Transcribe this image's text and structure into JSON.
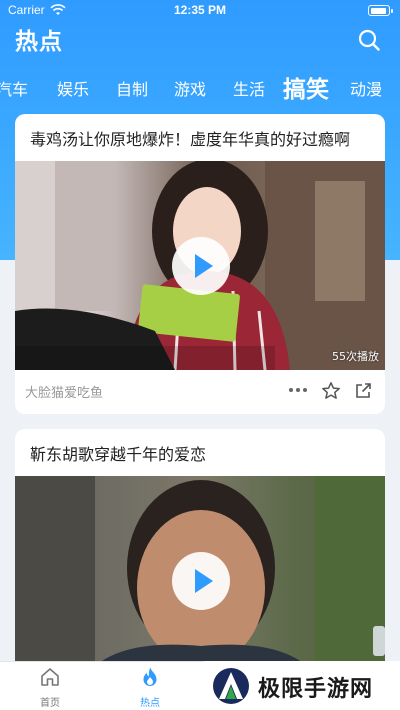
{
  "status_bar": {
    "carrier": "Carrier",
    "time": "12:35 PM"
  },
  "header": {
    "title": "热点",
    "search_icon": "search-icon"
  },
  "tabs": [
    {
      "label": "汽车",
      "active": false
    },
    {
      "label": "娱乐",
      "active": false
    },
    {
      "label": "自制",
      "active": false
    },
    {
      "label": "游戏",
      "active": false
    },
    {
      "label": "生活",
      "active": false
    },
    {
      "label": "搞笑",
      "active": true
    },
    {
      "label": "动漫",
      "active": false
    }
  ],
  "feed": [
    {
      "title": "毒鸡汤让你原地爆炸！虚度年华真的好过瘾啊",
      "play_count": "55次播放",
      "author": "大脸猫爱吃鱼"
    },
    {
      "title": "靳东胡歌穿越千年的爱恋"
    }
  ],
  "bottom_nav": [
    {
      "label": "首页",
      "icon": "home-icon",
      "active": false
    },
    {
      "label": "热点",
      "icon": "flame-icon",
      "active": true
    }
  ],
  "watermark": {
    "text": "极限手游网"
  },
  "colors": {
    "accent": "#2f9bff",
    "background": "#eef2f6"
  }
}
